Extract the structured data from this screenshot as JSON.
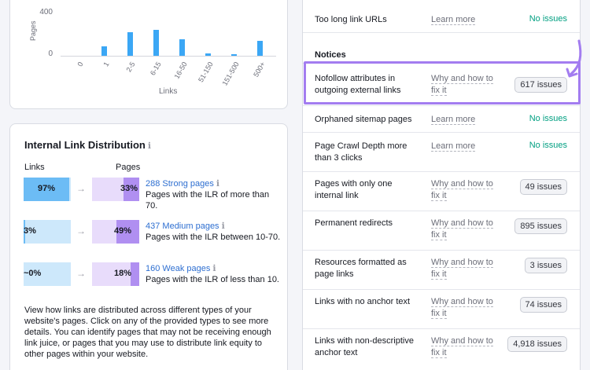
{
  "pages_chart": {
    "chart_data": {
      "type": "bar",
      "categories": [
        "0",
        "1",
        "2-5",
        "6-15",
        "16-50",
        "51-150",
        "151-500",
        "500+"
      ],
      "values": [
        0,
        85,
        220,
        240,
        150,
        20,
        15,
        140
      ],
      "ylabel": "Pages",
      "xlabel": "Links",
      "yticks": [
        "400",
        "0"
      ],
      "ylim": [
        0,
        400
      ],
      "grid": false,
      "bar_color": "#3ba7f5"
    }
  },
  "link_distribution": {
    "title": "Internal Link Distribution",
    "info_icon": "ℹ",
    "links_col": "Links",
    "pages_col": "Pages",
    "arrow": "→",
    "bands": [
      {
        "links_pct": "97%",
        "links_fill": 0.97,
        "pages_pct": "33%",
        "pages_fill": 0.33,
        "link": "288 Strong pages",
        "desc": "Pages with the ILR of more than 70."
      },
      {
        "links_pct": "3%",
        "links_fill": 0.03,
        "pages_pct": "49%",
        "pages_fill": 0.49,
        "link": "437 Medium pages",
        "desc": "Pages with the ILR between 10-70."
      },
      {
        "links_pct": "~0%",
        "links_fill": 0.0,
        "pages_pct": "18%",
        "pages_fill": 0.18,
        "link": "160 Weak pages",
        "desc": "Pages with the ILR of less than 10."
      }
    ],
    "description": "View how links are distributed across different types of your website's pages. Click on any of the provided types to see more details. You can identify pages that may not be receiving enough link juice, or pages that you may use to distribute link equity to other pages within your website."
  },
  "issues": {
    "top_row": {
      "label": "Too long link URLs",
      "help": "Learn more",
      "status": "No issues"
    },
    "notices_heading": "Notices",
    "rows": [
      {
        "label": "Nofollow attributes in outgoing external links",
        "help": "Why and how to fix it",
        "badge": "617 issues"
      },
      {
        "label": "Orphaned sitemap pages",
        "help": "Learn more",
        "status": "No issues"
      },
      {
        "label": "Page Crawl Depth more than 3 clicks",
        "help": "Learn more",
        "status": "No issues"
      },
      {
        "label": "Pages with only one internal link",
        "help": "Why and how to fix it",
        "badge": "49 issues"
      },
      {
        "label": "Permanent redirects",
        "help": "Why and how to fix it",
        "badge": "895 issues"
      },
      {
        "label": "Resources formatted as page links",
        "help": "Why and how to fix it",
        "badge": "3 issues"
      },
      {
        "label": "Links with no anchor text",
        "help": "Why and how to fix it",
        "badge": "74 issues"
      },
      {
        "label": "Links with non-descriptive anchor text",
        "help": "Why and how to fix it",
        "badge": "4,918 issues"
      }
    ],
    "highlight_color": "#a37df0"
  }
}
